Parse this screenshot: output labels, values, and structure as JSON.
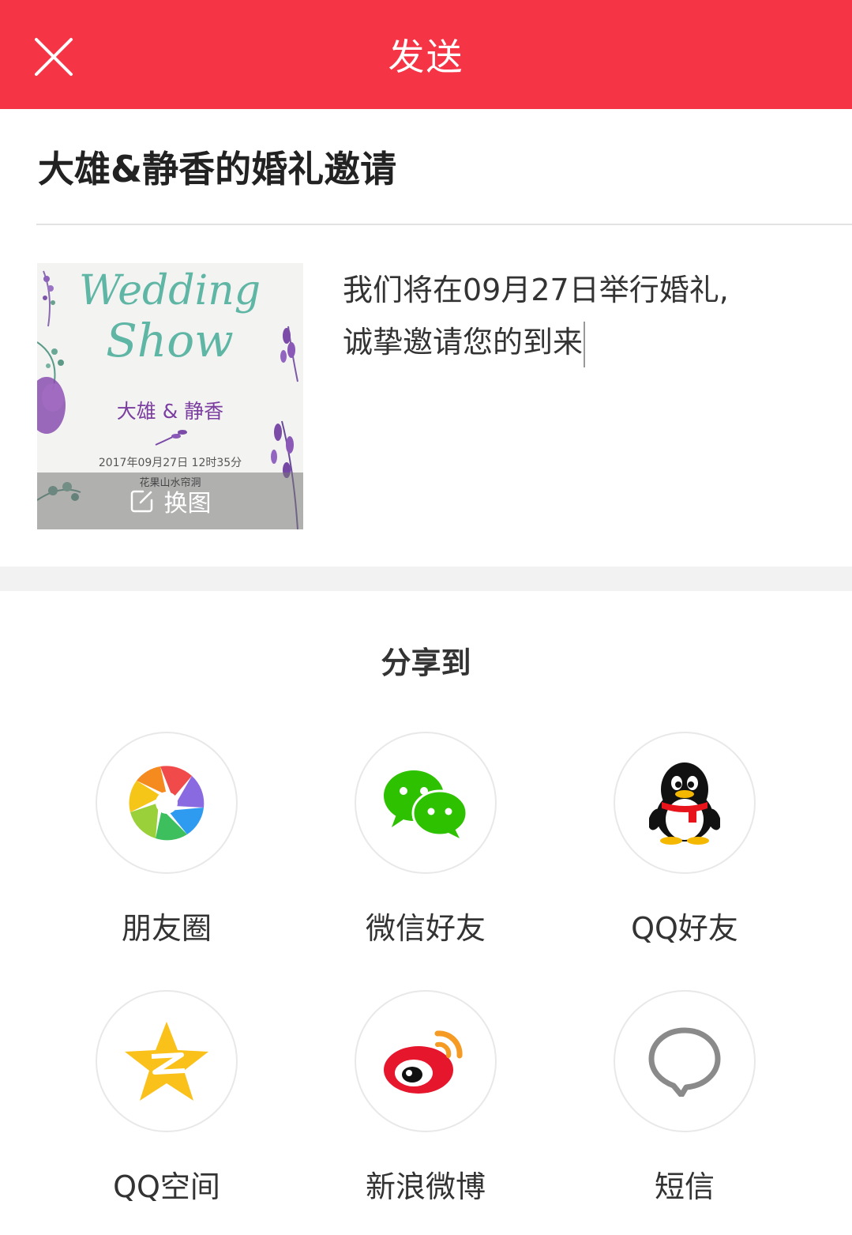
{
  "topbar": {
    "title": "发送",
    "close_icon": "close-icon",
    "bg_color": "#f53445"
  },
  "invite": {
    "title": "大雄&静香的婚礼邀请",
    "message_line1": "我们将在09月27日举行婚礼,",
    "message_line2": "诚挚邀请您的到来"
  },
  "card": {
    "script_line1": "Wedding",
    "script_line2": "Show",
    "names": "大雄 & 静香",
    "datetime": "2017年09月27日 12时35分",
    "place": "花果山水帘洞",
    "change_label": "换图",
    "change_icon": "edit-icon"
  },
  "share": {
    "title": "分享到",
    "items": [
      {
        "label": "朋友圈",
        "icon": "moments-icon"
      },
      {
        "label": "微信好友",
        "icon": "wechat-icon"
      },
      {
        "label": "QQ好友",
        "icon": "qq-icon"
      },
      {
        "label": "QQ空间",
        "icon": "qzone-icon"
      },
      {
        "label": "新浪微博",
        "icon": "weibo-icon"
      },
      {
        "label": "短信",
        "icon": "sms-icon"
      }
    ]
  }
}
